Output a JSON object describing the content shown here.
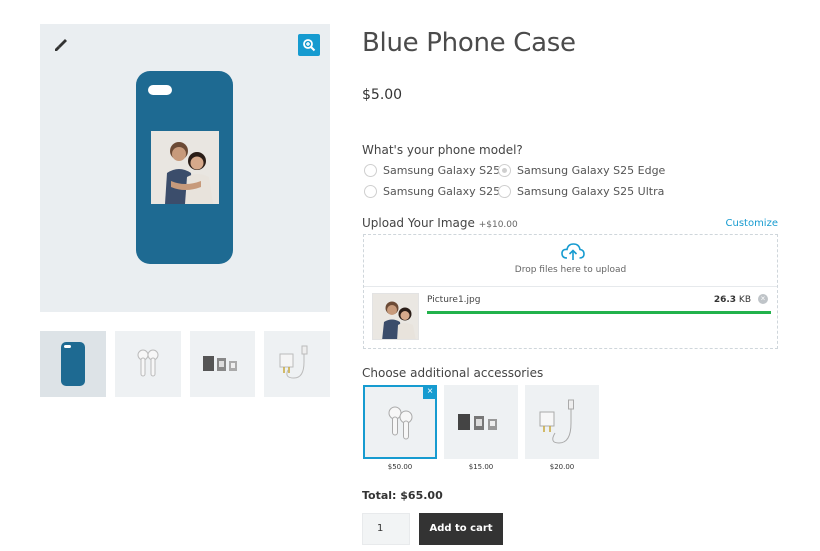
{
  "product": {
    "title": "Blue Phone Case",
    "price": "$5.00"
  },
  "gallery": {
    "brush_icon": "brush-icon",
    "zoom_icon": "zoom-in-icon",
    "case_color": "#1e6a92",
    "accent": "#169bd0",
    "thumbnails": [
      "phone-case",
      "earbuds",
      "sim-cards",
      "charger"
    ]
  },
  "phone_model": {
    "question": "What's your phone model?",
    "options": [
      "Samsung Galaxy S25",
      "Samsung Galaxy S25 Edge",
      "Samsung Galaxy S25+",
      "Samsung Galaxy S25 Ultra"
    ],
    "selected": "Samsung Galaxy S25 Edge"
  },
  "upload": {
    "label": "Upload Your Image",
    "extra_price": "+$10.00",
    "customize_link": "Customize",
    "drop_text": "Drop files here to upload",
    "file": {
      "name": "Picture1.jpg",
      "size_value": "26.3",
      "size_unit": " KB",
      "progress_percent": 100,
      "progress_color": "#22b24c"
    }
  },
  "accessories": {
    "label": "Choose additional accessories",
    "items": [
      {
        "name": "earbuds",
        "price": "$50.00",
        "selected": true
      },
      {
        "name": "sim-cards",
        "price": "$15.00",
        "selected": false
      },
      {
        "name": "charger",
        "price": "$20.00",
        "selected": false
      }
    ],
    "remove_glyph": "×"
  },
  "cart": {
    "total": "Total: $65.00",
    "quantity": "1",
    "add_label": "Add to cart"
  }
}
